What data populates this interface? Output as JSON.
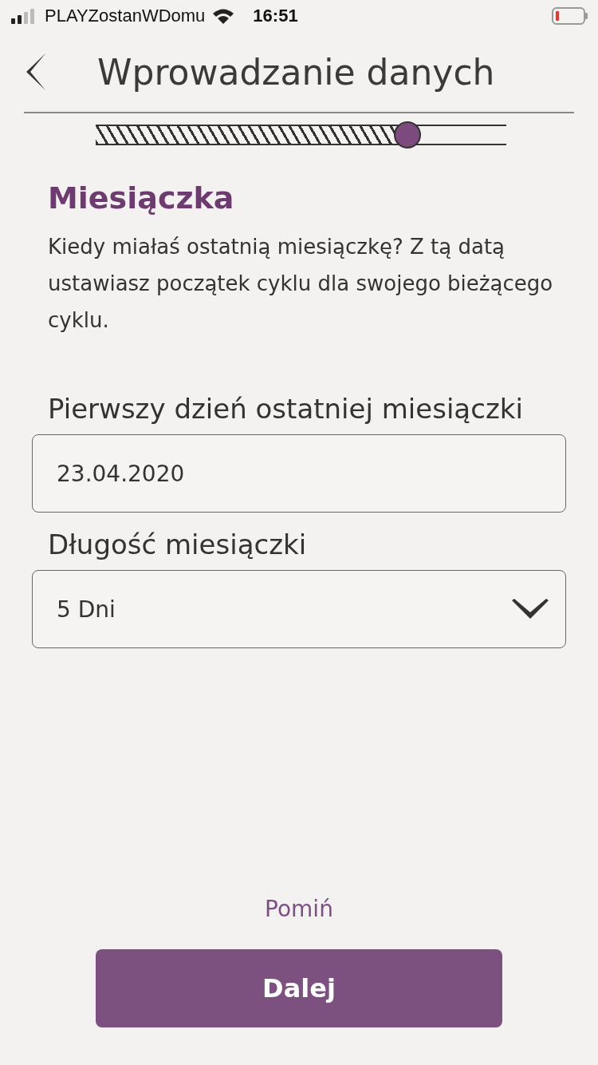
{
  "status_bar": {
    "carrier": "PLAYZostanWDomu",
    "time": "16:51"
  },
  "header": {
    "title": "Wprowadzanie danych"
  },
  "progress": {
    "level": 0.76
  },
  "section": {
    "title": "Miesiączka",
    "description": "Kiedy miałaś ostatnią miesiączkę? Z tą datą ustawiasz początek cyklu dla swojego bieżącego cyklu."
  },
  "fields": [
    {
      "kind": "date",
      "label": "Pierwszy dzień ostatniej miesiączki",
      "value": "23.04.2020"
    },
    {
      "kind": "select",
      "label": "Długość miesiączki",
      "value": "5 Dni"
    }
  ],
  "skip_link": "Pomiń",
  "next_button": "Dalej"
}
